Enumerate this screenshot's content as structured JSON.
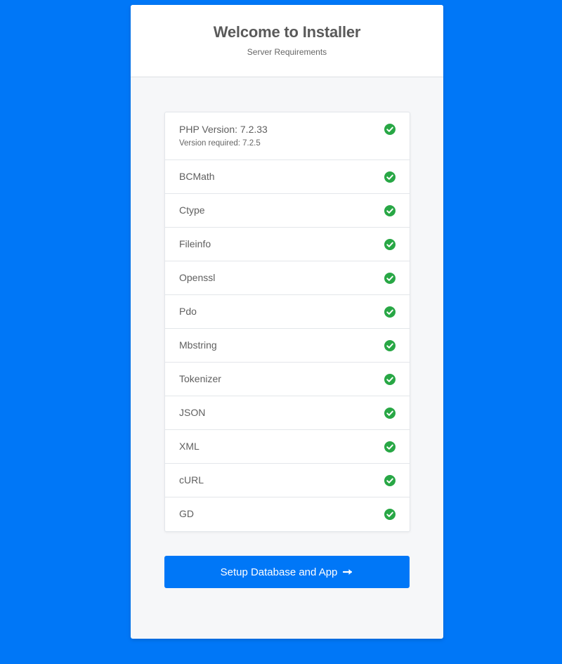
{
  "header": {
    "title": "Welcome to Installer",
    "subtitle": "Server Requirements"
  },
  "php": {
    "label": "PHP Version: 7.2.33",
    "required": "Version required: 7.2.5",
    "status_icon": "check-circle-icon"
  },
  "requirements": [
    {
      "label": "BCMath",
      "status_icon": "check-circle-icon"
    },
    {
      "label": "Ctype",
      "status_icon": "check-circle-icon"
    },
    {
      "label": "Fileinfo",
      "status_icon": "check-circle-icon"
    },
    {
      "label": "Openssl",
      "status_icon": "check-circle-icon"
    },
    {
      "label": "Pdo",
      "status_icon": "check-circle-icon"
    },
    {
      "label": "Mbstring",
      "status_icon": "check-circle-icon"
    },
    {
      "label": "Tokenizer",
      "status_icon": "check-circle-icon"
    },
    {
      "label": "JSON",
      "status_icon": "check-circle-icon"
    },
    {
      "label": "XML",
      "status_icon": "check-circle-icon"
    },
    {
      "label": "cURL",
      "status_icon": "check-circle-icon"
    },
    {
      "label": "GD",
      "status_icon": "check-circle-icon"
    }
  ],
  "action": {
    "label": "Setup Database and App",
    "icon": "arrow-right-icon"
  },
  "colors": {
    "background": "#0077f7",
    "button": "#0077f7",
    "check": "#28a745"
  }
}
